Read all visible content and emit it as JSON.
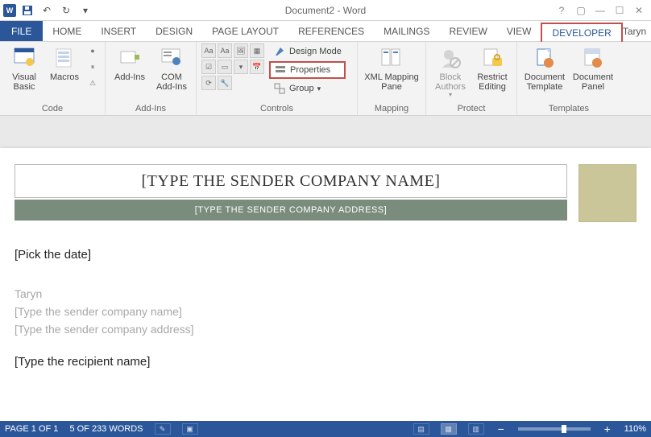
{
  "titlebar": {
    "title": "Document2 - Word"
  },
  "tabs": {
    "file": "FILE",
    "items": [
      "HOME",
      "INSERT",
      "DESIGN",
      "PAGE LAYOUT",
      "REFERENCES",
      "MAILINGS",
      "REVIEW",
      "VIEW",
      "DEVELOPER"
    ],
    "active_index": 8,
    "user_name": "Taryn"
  },
  "ribbon": {
    "code": {
      "label": "Code",
      "visual_basic": "Visual\nBasic",
      "macros": "Macros"
    },
    "addins": {
      "label": "Add-Ins",
      "addins": "Add-Ins",
      "com_addins": "COM\nAdd-Ins"
    },
    "controls": {
      "label": "Controls",
      "design_mode": "Design Mode",
      "properties": "Properties",
      "group": "Group"
    },
    "mapping": {
      "label": "Mapping",
      "xml_mapping_pane": "XML Mapping\nPane"
    },
    "protect": {
      "label": "Protect",
      "block_authors": "Block\nAuthors",
      "restrict_editing": "Restrict\nEditing"
    },
    "templates": {
      "label": "Templates",
      "document_template": "Document\nTemplate",
      "document_panel": "Document\nPanel"
    }
  },
  "document": {
    "company_name_placeholder": "[TYPE THE SENDER COMPANY NAME]",
    "company_addr_placeholder": "[TYPE THE SENDER COMPANY ADDRESS]",
    "pick_date": "[Pick the date]",
    "user": "Taryn",
    "sender_company_name_ph": "[Type the sender company name]",
    "sender_company_addr_ph": "[Type the sender company address]",
    "recipient_name_ph": "[Type the recipient name]"
  },
  "statusbar": {
    "page": "PAGE 1 OF 1",
    "words": "5 OF 233 WORDS",
    "zoom": "110%"
  }
}
